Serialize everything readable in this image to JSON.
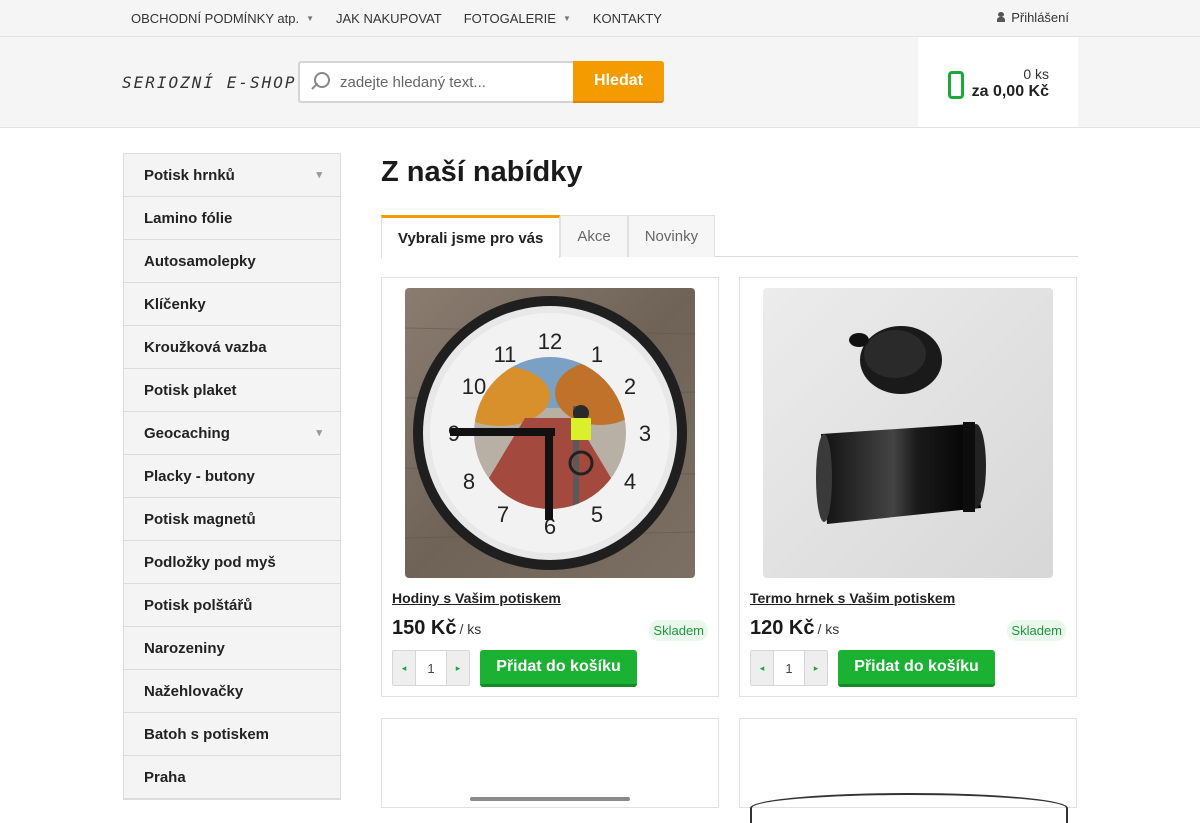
{
  "topnav": {
    "items": [
      {
        "label": "OBCHODNÍ PODMÍNKY atp.",
        "has_dropdown": true
      },
      {
        "label": "JAK NAKUPOVAT",
        "has_dropdown": false
      },
      {
        "label": "FOTOGALERIE",
        "has_dropdown": true
      },
      {
        "label": "KONTAKTY",
        "has_dropdown": false
      }
    ],
    "login_label": "Přihlášení",
    "login_icon": "user-icon",
    "dropdown_icon": "caret-down-icon"
  },
  "header": {
    "logo_text": "SERIOZNÍ E-SHOP",
    "search_placeholder": "zadejte hledaný text...",
    "search_button": "Hledat",
    "search_icon": "magnifier-icon",
    "cart": {
      "icon": "cart-icon",
      "quantity": "0 ks",
      "total": "za 0,00 Kč"
    }
  },
  "sidebar": {
    "categories": [
      {
        "label": "Potisk hrnků",
        "expandable": true
      },
      {
        "label": "Lamino fólie",
        "expandable": false
      },
      {
        "label": "Autosamolepky",
        "expandable": false
      },
      {
        "label": "Klíčenky",
        "expandable": false
      },
      {
        "label": "Kroužková vazba",
        "expandable": false
      },
      {
        "label": "Potisk plaket",
        "expandable": false
      },
      {
        "label": "Geocaching",
        "expandable": true
      },
      {
        "label": "Placky - butony",
        "expandable": false
      },
      {
        "label": "Potisk magnetů",
        "expandable": false
      },
      {
        "label": "Podložky pod myš",
        "expandable": false
      },
      {
        "label": "Potisk polštářů",
        "expandable": false
      },
      {
        "label": "Narozeniny",
        "expandable": false
      },
      {
        "label": "Nažehlovačky",
        "expandable": false
      },
      {
        "label": "Batoh s potiskem",
        "expandable": false
      },
      {
        "label": "Praha",
        "expandable": false
      }
    ]
  },
  "main": {
    "title": "Z naší nabídky",
    "tabs": [
      {
        "label": "Vybrali jsme pro vás",
        "active": true
      },
      {
        "label": "Akce",
        "active": false
      },
      {
        "label": "Novinky",
        "active": false
      }
    ],
    "products": [
      {
        "name": "Hodiny s Vašim potiskem",
        "price": "150 Kč",
        "unit": "/ ks",
        "stock": "Skladem",
        "quantity": "1",
        "add_label": "Přidat do košíku",
        "image": "wall-clock-photo"
      },
      {
        "name": "Termo hrnek s Vašim potiskem",
        "price": "120 Kč",
        "unit": "/ ks",
        "stock": "Skladem",
        "quantity": "1",
        "add_label": "Přidat do košíku",
        "image": "thermo-mug-photo"
      }
    ]
  },
  "colors": {
    "accent_orange": "#f49b00",
    "accent_green": "#1bb234",
    "background_gray": "#f5f5f5"
  }
}
